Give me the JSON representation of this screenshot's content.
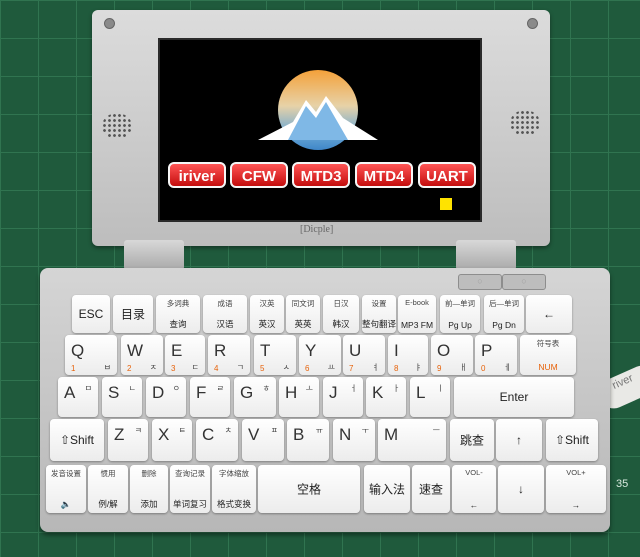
{
  "mat": {
    "numbers": [
      "35"
    ]
  },
  "cable": {
    "text": "river"
  },
  "screen": {
    "buttons": [
      "iriver",
      "CFW",
      "MTD3",
      "MTD4",
      "UART"
    ],
    "brand_label": "[Dicple]",
    "colors": {
      "button": "#d81b1b",
      "accent_square": "#ffe300"
    }
  },
  "power_buttons": [
    "○",
    "○"
  ],
  "keyboard": {
    "row1": [
      {
        "main": "ESC"
      },
      {
        "main": "目录"
      },
      {
        "top": "多词典",
        "main": "查询"
      },
      {
        "top": "成语",
        "main": "汉语"
      },
      {
        "top": "汉英",
        "main": "英汉"
      },
      {
        "top": "同文词",
        "main": "英英"
      },
      {
        "top": "日汉",
        "main": "韩汉"
      },
      {
        "top": "设置",
        "main": "整句翻译"
      },
      {
        "top": "E-book",
        "main": "MP3 FM"
      },
      {
        "top": "前—单词",
        "main": "Pg Up"
      },
      {
        "top": "后—单词",
        "main": "Pg Dn"
      },
      {
        "main": "←"
      }
    ],
    "row2": [
      {
        "main": "Q",
        "num": "1",
        "han": "ㅂ"
      },
      {
        "main": "W",
        "num": "2",
        "han": "ㅈ"
      },
      {
        "main": "E",
        "num": "3",
        "han": "ㄷ"
      },
      {
        "main": "R",
        "num": "4",
        "han": "ㄱ"
      },
      {
        "main": "T",
        "num": "5",
        "han": "ㅅ"
      },
      {
        "main": "Y",
        "num": "6",
        "han": "ㅛ"
      },
      {
        "main": "U",
        "num": "7",
        "han": "ㅕ"
      },
      {
        "main": "I",
        "num": "8",
        "han": "ㅑ"
      },
      {
        "main": "O",
        "num": "9",
        "han": "ㅐ"
      },
      {
        "main": "P",
        "num": "0",
        "han": "ㅔ"
      },
      {
        "top": "符号表",
        "main": "NUM"
      }
    ],
    "row3": [
      {
        "main": "A",
        "han": "ㅁ"
      },
      {
        "main": "S",
        "han": "ㄴ"
      },
      {
        "main": "D",
        "han": "ㅇ"
      },
      {
        "main": "F",
        "han": "ㄹ"
      },
      {
        "main": "G",
        "han": "ㅎ"
      },
      {
        "main": "H",
        "han": "ㅗ"
      },
      {
        "main": "J",
        "han": "ㅓ"
      },
      {
        "main": "K",
        "han": "ㅏ"
      },
      {
        "main": "L",
        "han": "ㅣ"
      },
      {
        "main": "Enter"
      }
    ],
    "row4": [
      {
        "main": "⇧Shift"
      },
      {
        "main": "Z",
        "han": "ㅋ"
      },
      {
        "main": "X",
        "han": "ㅌ"
      },
      {
        "main": "C",
        "han": "ㅊ"
      },
      {
        "main": "V",
        "han": "ㅍ"
      },
      {
        "main": "B",
        "han": "ㅠ"
      },
      {
        "main": "N",
        "han": "ㅜ"
      },
      {
        "main": "M",
        "han": "ㅡ"
      },
      {
        "main": "跳查"
      },
      {
        "main": "↑"
      },
      {
        "main": "⇧Shift"
      }
    ],
    "row5": [
      {
        "top": "发音设置",
        "main": "🔈"
      },
      {
        "top": "惯用",
        "main": "例/解"
      },
      {
        "top": "删除",
        "main": "添加"
      },
      {
        "top": "查询记录",
        "main": "单词复习"
      },
      {
        "top": "字体缩放",
        "main": "格式变换"
      },
      {
        "main": "空格"
      },
      {
        "main": "输入法"
      },
      {
        "main": "速查"
      },
      {
        "top": "VOL-",
        "main": "←"
      },
      {
        "main": "↓"
      },
      {
        "top": "VOL+",
        "main": "→"
      }
    ]
  }
}
